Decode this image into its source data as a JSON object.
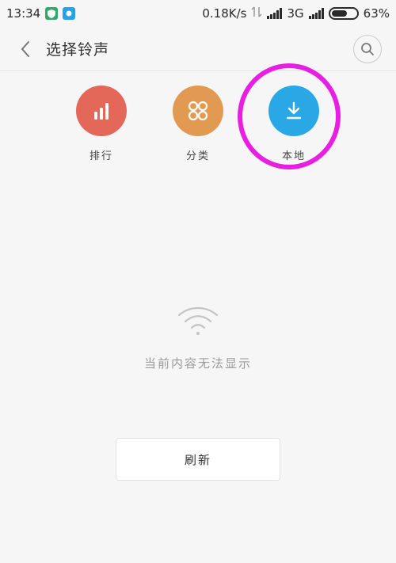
{
  "status_bar": {
    "time": "13:34",
    "net_speed": "0.18K/s",
    "network_type": "3G",
    "battery_percent": "63%",
    "battery_level": 0.63,
    "app_icons": [
      "shield-icon",
      "app-icon"
    ]
  },
  "header": {
    "title": "选择铃声"
  },
  "categories": [
    {
      "label": "排行",
      "icon": "chart-bars-icon",
      "color": "#e4685a"
    },
    {
      "label": "分类",
      "icon": "four-circles-icon",
      "color": "#e29a52"
    },
    {
      "label": "本地",
      "icon": "download-icon",
      "color": "#2aa8e6"
    }
  ],
  "highlight_color": "#e81ee3",
  "empty_state": {
    "icon": "wifi-icon",
    "message": "当前内容无法显示"
  },
  "refresh_button": {
    "label": "刷新"
  }
}
